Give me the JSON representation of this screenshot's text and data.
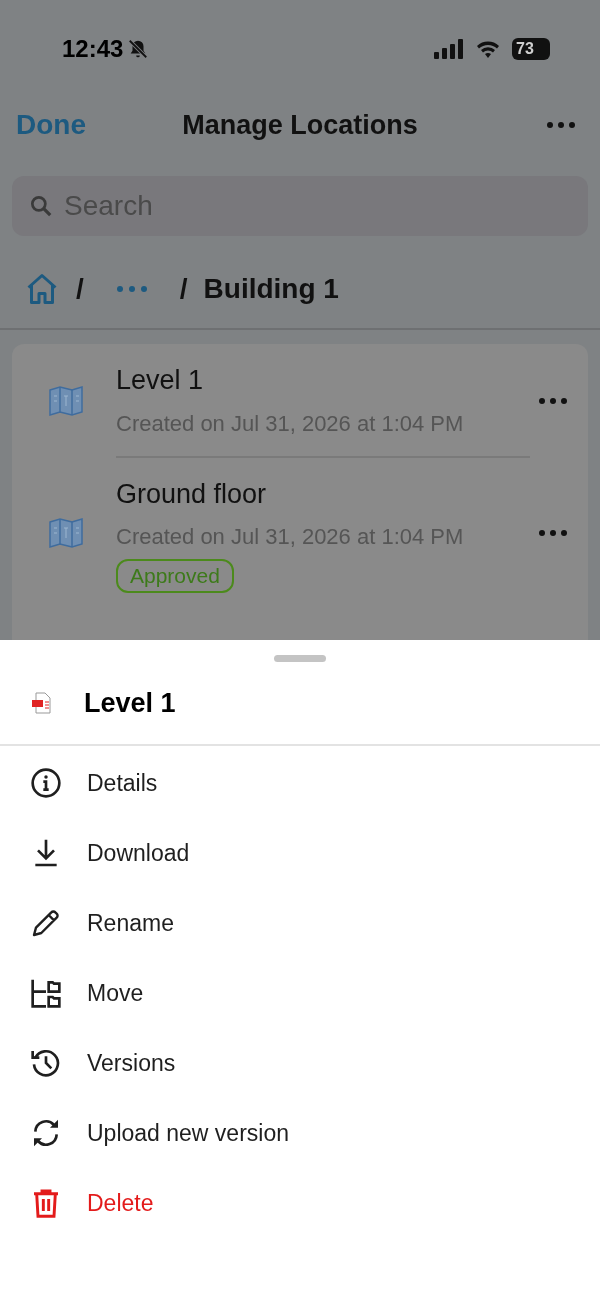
{
  "status_bar": {
    "time": "12:43",
    "battery": "73"
  },
  "nav": {
    "back": "Done",
    "title": "Manage Locations"
  },
  "search": {
    "placeholder": "Search"
  },
  "breadcrumb": [
    {
      "kind": "home"
    },
    {
      "kind": "more",
      "separator": "/"
    },
    {
      "kind": "current",
      "label": "Building 1",
      "separator": "/"
    }
  ],
  "items": [
    {
      "name": "Level 1",
      "meta": "Created on Jul 31, 2026 at 1:04 PM"
    },
    {
      "name": "Ground floor",
      "meta": "Created on Jul 31, 2026 at 1:04 PM",
      "badge": "Approved"
    }
  ],
  "sheet": {
    "title": "Level 1",
    "actions": [
      {
        "label": "Details",
        "kind": "normal"
      },
      {
        "label": "Download",
        "kind": "normal"
      },
      {
        "label": "Rename",
        "kind": "normal"
      },
      {
        "label": "Move",
        "kind": "normal"
      },
      {
        "label": "Versions",
        "kind": "normal"
      },
      {
        "label": "Upload new version",
        "kind": "normal"
      },
      {
        "label": "Delete",
        "kind": "destructive"
      }
    ]
  }
}
